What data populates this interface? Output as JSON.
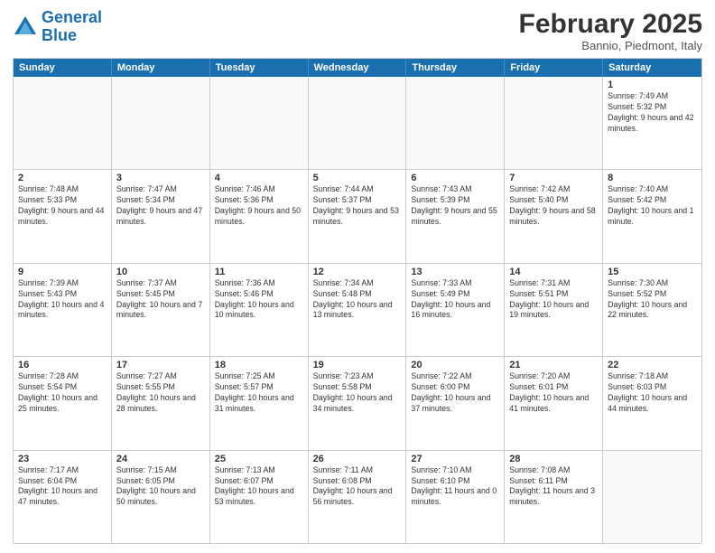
{
  "header": {
    "logo_line1": "General",
    "logo_line2": "Blue",
    "month": "February 2025",
    "location": "Bannio, Piedmont, Italy"
  },
  "days_of_week": [
    "Sunday",
    "Monday",
    "Tuesday",
    "Wednesday",
    "Thursday",
    "Friday",
    "Saturday"
  ],
  "weeks": [
    [
      {
        "day": "",
        "text": "",
        "empty": true
      },
      {
        "day": "",
        "text": "",
        "empty": true
      },
      {
        "day": "",
        "text": "",
        "empty": true
      },
      {
        "day": "",
        "text": "",
        "empty": true
      },
      {
        "day": "",
        "text": "",
        "empty": true
      },
      {
        "day": "",
        "text": "",
        "empty": true
      },
      {
        "day": "1",
        "text": "Sunrise: 7:49 AM\nSunset: 5:32 PM\nDaylight: 9 hours and 42 minutes.",
        "empty": false
      }
    ],
    [
      {
        "day": "2",
        "text": "Sunrise: 7:48 AM\nSunset: 5:33 PM\nDaylight: 9 hours and 44 minutes.",
        "empty": false
      },
      {
        "day": "3",
        "text": "Sunrise: 7:47 AM\nSunset: 5:34 PM\nDaylight: 9 hours and 47 minutes.",
        "empty": false
      },
      {
        "day": "4",
        "text": "Sunrise: 7:46 AM\nSunset: 5:36 PM\nDaylight: 9 hours and 50 minutes.",
        "empty": false
      },
      {
        "day": "5",
        "text": "Sunrise: 7:44 AM\nSunset: 5:37 PM\nDaylight: 9 hours and 53 minutes.",
        "empty": false
      },
      {
        "day": "6",
        "text": "Sunrise: 7:43 AM\nSunset: 5:39 PM\nDaylight: 9 hours and 55 minutes.",
        "empty": false
      },
      {
        "day": "7",
        "text": "Sunrise: 7:42 AM\nSunset: 5:40 PM\nDaylight: 9 hours and 58 minutes.",
        "empty": false
      },
      {
        "day": "8",
        "text": "Sunrise: 7:40 AM\nSunset: 5:42 PM\nDaylight: 10 hours and 1 minute.",
        "empty": false
      }
    ],
    [
      {
        "day": "9",
        "text": "Sunrise: 7:39 AM\nSunset: 5:43 PM\nDaylight: 10 hours and 4 minutes.",
        "empty": false
      },
      {
        "day": "10",
        "text": "Sunrise: 7:37 AM\nSunset: 5:45 PM\nDaylight: 10 hours and 7 minutes.",
        "empty": false
      },
      {
        "day": "11",
        "text": "Sunrise: 7:36 AM\nSunset: 5:46 PM\nDaylight: 10 hours and 10 minutes.",
        "empty": false
      },
      {
        "day": "12",
        "text": "Sunrise: 7:34 AM\nSunset: 5:48 PM\nDaylight: 10 hours and 13 minutes.",
        "empty": false
      },
      {
        "day": "13",
        "text": "Sunrise: 7:33 AM\nSunset: 5:49 PM\nDaylight: 10 hours and 16 minutes.",
        "empty": false
      },
      {
        "day": "14",
        "text": "Sunrise: 7:31 AM\nSunset: 5:51 PM\nDaylight: 10 hours and 19 minutes.",
        "empty": false
      },
      {
        "day": "15",
        "text": "Sunrise: 7:30 AM\nSunset: 5:52 PM\nDaylight: 10 hours and 22 minutes.",
        "empty": false
      }
    ],
    [
      {
        "day": "16",
        "text": "Sunrise: 7:28 AM\nSunset: 5:54 PM\nDaylight: 10 hours and 25 minutes.",
        "empty": false
      },
      {
        "day": "17",
        "text": "Sunrise: 7:27 AM\nSunset: 5:55 PM\nDaylight: 10 hours and 28 minutes.",
        "empty": false
      },
      {
        "day": "18",
        "text": "Sunrise: 7:25 AM\nSunset: 5:57 PM\nDaylight: 10 hours and 31 minutes.",
        "empty": false
      },
      {
        "day": "19",
        "text": "Sunrise: 7:23 AM\nSunset: 5:58 PM\nDaylight: 10 hours and 34 minutes.",
        "empty": false
      },
      {
        "day": "20",
        "text": "Sunrise: 7:22 AM\nSunset: 6:00 PM\nDaylight: 10 hours and 37 minutes.",
        "empty": false
      },
      {
        "day": "21",
        "text": "Sunrise: 7:20 AM\nSunset: 6:01 PM\nDaylight: 10 hours and 41 minutes.",
        "empty": false
      },
      {
        "day": "22",
        "text": "Sunrise: 7:18 AM\nSunset: 6:03 PM\nDaylight: 10 hours and 44 minutes.",
        "empty": false
      }
    ],
    [
      {
        "day": "23",
        "text": "Sunrise: 7:17 AM\nSunset: 6:04 PM\nDaylight: 10 hours and 47 minutes.",
        "empty": false
      },
      {
        "day": "24",
        "text": "Sunrise: 7:15 AM\nSunset: 6:05 PM\nDaylight: 10 hours and 50 minutes.",
        "empty": false
      },
      {
        "day": "25",
        "text": "Sunrise: 7:13 AM\nSunset: 6:07 PM\nDaylight: 10 hours and 53 minutes.",
        "empty": false
      },
      {
        "day": "26",
        "text": "Sunrise: 7:11 AM\nSunset: 6:08 PM\nDaylight: 10 hours and 56 minutes.",
        "empty": false
      },
      {
        "day": "27",
        "text": "Sunrise: 7:10 AM\nSunset: 6:10 PM\nDaylight: 11 hours and 0 minutes.",
        "empty": false
      },
      {
        "day": "28",
        "text": "Sunrise: 7:08 AM\nSunset: 6:11 PM\nDaylight: 11 hours and 3 minutes.",
        "empty": false
      },
      {
        "day": "",
        "text": "",
        "empty": true
      }
    ]
  ]
}
